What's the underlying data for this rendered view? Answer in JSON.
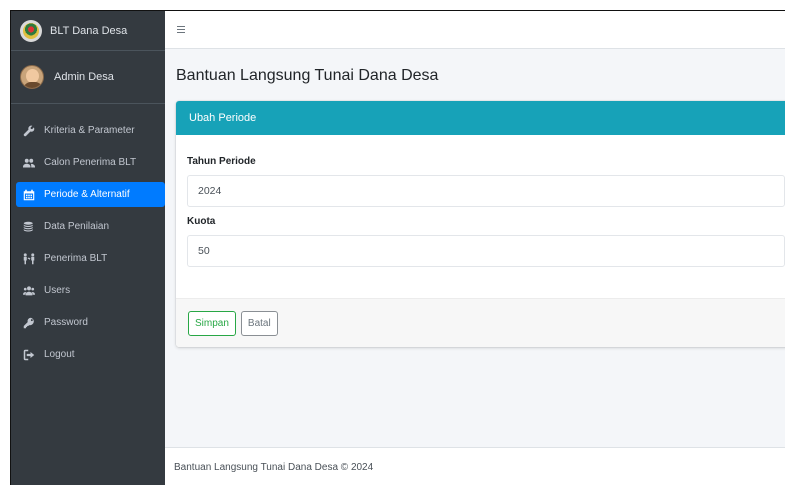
{
  "brand": {
    "title": "BLT Dana Desa"
  },
  "user": {
    "name": "Admin Desa"
  },
  "sidebar": {
    "items": [
      {
        "label": "Kriteria & Parameter",
        "icon": "wrench-icon",
        "active": false
      },
      {
        "label": "Calon Penerima BLT",
        "icon": "users-icon",
        "active": false
      },
      {
        "label": "Periode & Alternatif",
        "icon": "calendar-icon",
        "active": true
      },
      {
        "label": "Data Penilaian",
        "icon": "coins-icon",
        "active": false
      },
      {
        "label": "Penerima BLT",
        "icon": "people-arrows-icon",
        "active": false
      },
      {
        "label": "Users",
        "icon": "user-group-icon",
        "active": false
      },
      {
        "label": "Password",
        "icon": "key-icon",
        "active": false
      },
      {
        "label": "Logout",
        "icon": "sign-out-icon",
        "active": false
      }
    ]
  },
  "header": {
    "menu_icon": "hamburger-icon"
  },
  "main": {
    "page_title": "Bantuan Langsung Tunai Dana Desa",
    "card": {
      "title": "Ubah Periode",
      "fields": [
        {
          "label": "Tahun Periode",
          "value": "2024"
        },
        {
          "label": "Kuota",
          "value": "50"
        }
      ],
      "save_label": "Simpan",
      "cancel_label": "Batal"
    }
  },
  "footer": {
    "text": "Bantuan Langsung Tunai Dana Desa © 2024"
  },
  "colors": {
    "sidebar_bg": "#343a40",
    "active_item": "#007bff",
    "card_header": "#17a2b8",
    "save_button": "#28a745"
  }
}
